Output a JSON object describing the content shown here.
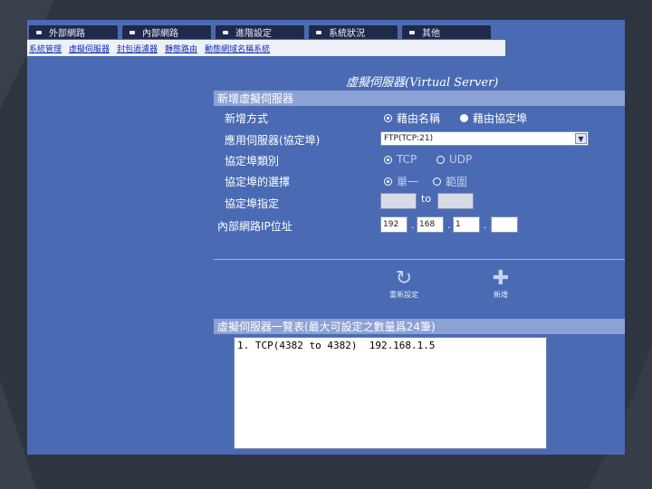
{
  "tabs": [
    "外部網路",
    "內部網路",
    "進階設定",
    "系統狀況",
    "其他"
  ],
  "subnav": [
    "系統管理",
    "虛擬伺服器",
    "封包過濾器",
    "靜態路由",
    "動態網域名稱系統"
  ],
  "page_title": "虛擬伺服器(Virtual Server)",
  "add_section": {
    "header": "新增虛擬伺服器",
    "method_label": "新增方式",
    "method_by_name": "藉由名稱",
    "method_by_port": "藉由協定埠",
    "app_server_label": "應用伺服器(協定埠)",
    "app_server_value": "FTP(TCP:21)",
    "protocol_type_label": "協定埠類別",
    "protocol_tcp": "TCP",
    "protocol_udp": "UDP",
    "port_choice_label": "協定埠的選擇",
    "port_single": "單一",
    "port_range": "範圍",
    "port_assign_label": "協定埠指定",
    "port_to": "to",
    "ip_label": "內部網路IP位址",
    "ip": [
      "192",
      "168",
      "1",
      ""
    ],
    "reset_label": "重新設定",
    "add_label": "新增"
  },
  "list_section": {
    "header": "虛擬伺服器一覽表(最大可設定之數量爲24筆)",
    "items": [
      "1. TCP(4382 to 4382)  192.168.1.5"
    ]
  }
}
